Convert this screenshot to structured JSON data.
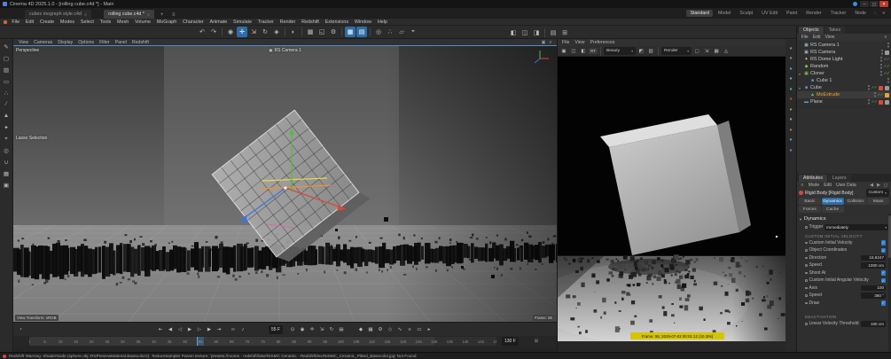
{
  "window": {
    "title": "Cinema 4D 2025.1.0 - [rolling cube.c4d *] - Main",
    "minimize_glyph": "─",
    "maximize_glyph": "▢",
    "close_glyph": "✕"
  },
  "document_tabs": {
    "tabs": [
      {
        "label": "cubes mograph style.c4d",
        "active": false
      },
      {
        "label": "rolling cube.c4d *",
        "active": true
      }
    ],
    "add_label": "+",
    "menu_glyph": "≡"
  },
  "layout_switcher": {
    "items": [
      "Standard",
      "Model",
      "Sculpt",
      "UV Edit",
      "Paint",
      "Render",
      "Tracker",
      "Node"
    ],
    "active": "Standard"
  },
  "menubar": {
    "items": [
      "File",
      "Edit",
      "Create",
      "Modes",
      "Select",
      "Tools",
      "Mesh",
      "Volume",
      "MoGraph",
      "Character",
      "Animate",
      "Simulate",
      "Tracker",
      "Render",
      "Redshift",
      "Extensions",
      "Window",
      "Help"
    ]
  },
  "toolbar": {
    "tools": [
      {
        "name": "undo-button",
        "glyph": "↶"
      },
      {
        "name": "redo-button",
        "glyph": "↷"
      },
      {
        "sep": true
      },
      {
        "name": "live-selection-tool",
        "glyph": "◉"
      },
      {
        "name": "move-tool",
        "glyph": "✛",
        "active": true
      },
      {
        "name": "scale-tool",
        "glyph": "⇲"
      },
      {
        "name": "rotate-tool",
        "glyph": "↻"
      },
      {
        "name": "last-tool-button",
        "glyph": "◈"
      },
      {
        "sep": true
      },
      {
        "name": "coordinate-system-toggle",
        "glyph": "◐"
      },
      {
        "sep": true
      },
      {
        "name": "render-view-button",
        "glyph": "▦"
      },
      {
        "name": "render-region-button",
        "glyph": "◱"
      },
      {
        "name": "render-settings-button",
        "glyph": "⚙"
      },
      {
        "sep": true
      },
      {
        "name": "simulate-scene-toggle",
        "glyph": "▦",
        "active": true
      },
      {
        "name": "simulate-cache-toggle",
        "glyph": "▤",
        "active": true
      },
      {
        "sep": true
      },
      {
        "name": "snap-toggle",
        "glyph": "◎"
      },
      {
        "name": "quantize-toggle",
        "glyph": "∴"
      },
      {
        "name": "workplane-toggle",
        "glyph": "▱"
      },
      {
        "name": "axis-toggle",
        "glyph": "⌖"
      }
    ],
    "right_tools": [
      {
        "name": "layout-single-view-button",
        "glyph": "◧"
      },
      {
        "name": "layout-quad-view-button",
        "glyph": "◫"
      },
      {
        "name": "layout-panel-button",
        "glyph": "◨"
      },
      {
        "sep": true
      },
      {
        "name": "content-browser-button",
        "glyph": "▤"
      },
      {
        "name": "coordinates-manager-button",
        "glyph": "⊞"
      }
    ]
  },
  "left_palette": {
    "tools": [
      {
        "name": "make-editable-button",
        "glyph": "✎"
      },
      {
        "name": "model-mode-button",
        "glyph": "▢"
      },
      {
        "name": "texture-mode-button",
        "glyph": "▨"
      },
      {
        "name": "workplane-mode-button",
        "glyph": "▭"
      },
      {
        "name": "points-mode-button",
        "glyph": "∴"
      },
      {
        "name": "edges-mode-button",
        "glyph": "∕"
      },
      {
        "name": "polygons-mode-button",
        "glyph": "▲"
      },
      {
        "name": "tweak-mode-button",
        "glyph": "✦"
      },
      {
        "name": "enable-axis-button",
        "glyph": "⌖"
      },
      {
        "name": "viewport-solo-button",
        "glyph": "◎"
      },
      {
        "name": "snap-button",
        "glyph": "∪"
      },
      {
        "name": "grid-snap-button",
        "glyph": "▦"
      },
      {
        "name": "locked-workplane-button",
        "glyph": "▣"
      }
    ]
  },
  "viewport": {
    "menus": [
      "View",
      "Cameras",
      "Display",
      "Options",
      "Filter",
      "Panel",
      "Redshift"
    ],
    "corner_icons": [
      {
        "name": "viewport-maximize-icon",
        "glyph": "▣"
      },
      {
        "name": "viewport-options-icon",
        "glyph": "≡"
      }
    ],
    "view_label": "Perspective",
    "camera_label": "RS Camera 1",
    "tool_hint": "Lasso Selection",
    "view_transform_label": "View Transform: sRGB",
    "stats_label": "Frame: 55"
  },
  "renderview": {
    "menus": [
      "File",
      "View",
      "Preferences"
    ],
    "left_icons": [
      {
        "name": "save-image-icon",
        "glyph": "▣"
      },
      {
        "name": "snapshot-icon",
        "glyph": "◫"
      },
      {
        "name": "ab-compare-icon",
        "glyph": "◧"
      }
    ],
    "rt_label": "RT",
    "aov": "Beauty",
    "channel_icons": [
      {
        "name": "rgb-channel-icon",
        "glyph": "◩"
      },
      {
        "name": "alpha-channel-icon",
        "glyph": "▨"
      }
    ],
    "engine": "Render",
    "right_icons": [
      {
        "name": "region-render-icon",
        "glyph": "▢"
      },
      {
        "name": "zoom-fit-icon",
        "glyph": "⇲"
      },
      {
        "name": "bucket-icon",
        "glyph": "▦"
      },
      {
        "name": "denoise-icon",
        "glyph": "◬"
      }
    ],
    "info_bar": "Frame: 55; 2025-07-03 00:01:12 (10.39s)"
  },
  "right_strip": {
    "icons": [
      {
        "name": "asset-browser-icon",
        "glyph": "●",
        "color": "#8d8d8d"
      },
      {
        "name": "material-icon",
        "glyph": "●",
        "color": "#7d8a99"
      },
      {
        "name": "sky-icon",
        "glyph": "●",
        "color": "#4f9bd6"
      },
      {
        "name": "floor-icon",
        "glyph": "●",
        "color": "#9a9a9a"
      },
      {
        "name": "environment-icon",
        "glyph": "●",
        "color": "#4cae9e"
      },
      {
        "name": "dynamics-icon",
        "glyph": "●",
        "color": "#c84b3c"
      },
      {
        "name": "mograph-icon",
        "glyph": "●",
        "color": "#6fae4f"
      },
      {
        "name": "volume-icon",
        "glyph": "●",
        "color": "#9a9a9a"
      },
      {
        "name": "field-icon",
        "glyph": "●",
        "color": "#b07a3e"
      },
      {
        "name": "camera-palette-icon",
        "glyph": "●",
        "color": "#8888aa"
      },
      {
        "name": "light-palette-icon",
        "glyph": "●",
        "color": "#5588cc"
      }
    ]
  },
  "objects_panel": {
    "tabs": [
      {
        "label": "Objects",
        "active": true
      },
      {
        "label": "Takes",
        "active": false
      }
    ],
    "menus": [
      "File",
      "Edit",
      "View"
    ],
    "menu_icon": "≡",
    "items": [
      {
        "label": "RS Camera 1",
        "type": "camera",
        "indent": 0,
        "checks": false,
        "tags": []
      },
      {
        "label": "RS Camera",
        "type": "camera",
        "indent": 0,
        "checks": false,
        "tags": [
          "gray"
        ]
      },
      {
        "label": "RS Dome Light",
        "type": "light",
        "indent": 0,
        "checks": true,
        "tags": []
      },
      {
        "label": "Random",
        "type": "effector",
        "indent": 0,
        "checks": true,
        "tags": []
      },
      {
        "label": "Cloner",
        "type": "cloner",
        "indent": 0,
        "checks": true,
        "expander": true,
        "tags": []
      },
      {
        "label": "Cube 1",
        "type": "cube",
        "indent": 1,
        "checks": false,
        "tags": []
      },
      {
        "label": "Cube",
        "type": "cube",
        "indent": 0,
        "checks": true,
        "expander": true,
        "tags": [
          "red",
          "gray"
        ]
      },
      {
        "label": "MoExtrude",
        "type": "moextrude",
        "indent": 1,
        "checks": true,
        "selected": true,
        "tags": [
          "orange"
        ]
      },
      {
        "label": "Plane",
        "type": "plane",
        "indent": 0,
        "checks": true,
        "tags": [
          "red",
          "gray"
        ]
      }
    ]
  },
  "attributes_panel": {
    "tabs": [
      {
        "label": "Attributes",
        "active": true
      },
      {
        "label": "Layers",
        "active": false
      }
    ],
    "menus": [
      "Mode",
      "Edit",
      "User Data"
    ],
    "menu_icon": "≡",
    "nav_icons": [
      {
        "name": "history-back-icon",
        "glyph": "◀"
      },
      {
        "name": "history-forward-icon",
        "glyph": "▶"
      },
      {
        "name": "lock-icon",
        "glyph": "◻"
      }
    ],
    "title": "Rigid Body [Rigid Body]",
    "preset": "Custom",
    "tab_buttons": [
      {
        "label": "Basic"
      },
      {
        "label": "Dynamics",
        "active": true
      },
      {
        "label": "Collision"
      },
      {
        "label": "Mass"
      },
      {
        "label": "Forces"
      },
      {
        "label": "Cache"
      }
    ],
    "section": "Dynamics",
    "rows": [
      {
        "type": "select",
        "label": "Trigger",
        "value": "Immediately"
      },
      {
        "type": "header",
        "label": "Custom Initial Velocity"
      },
      {
        "type": "check",
        "label": "Custom Initial Velocity",
        "checked": true
      },
      {
        "type": "check",
        "label": "Object Coordinates",
        "checked": true
      },
      {
        "type": "field",
        "label": "Direction",
        "value": "15.6247"
      },
      {
        "type": "field",
        "label": "Speed",
        "value": "1000 cm"
      },
      {
        "type": "check",
        "label": "Shoot At",
        "checked": true
      },
      {
        "type": "check",
        "label": "Custom Initial Angular Velocity",
        "checked": true
      },
      {
        "type": "field",
        "label": "Axis",
        "value": "100"
      },
      {
        "type": "field",
        "label": "Speed",
        "value": "360 °"
      },
      {
        "type": "check",
        "label": "Draw",
        "checked": true
      },
      {
        "type": "header",
        "label": "Deactivation",
        "gap": true
      },
      {
        "type": "field",
        "label": "Linear Velocity Threshold",
        "value": "100 cm"
      }
    ]
  },
  "timeline": {
    "ticks_start": 0,
    "ticks_end": 150,
    "tick_step": 5,
    "current_frame": 55,
    "range_end_frame": 130,
    "current_frame_label": "55 F",
    "range_end_label": "130 F",
    "nav_icon": "◔",
    "transport": [
      {
        "name": "go-to-start-button",
        "glyph": "⇤"
      },
      {
        "name": "previous-key-button",
        "glyph": "◀"
      },
      {
        "name": "previous-frame-button",
        "glyph": "◁"
      },
      {
        "name": "play-button",
        "glyph": "▶"
      },
      {
        "name": "next-frame-button",
        "glyph": "▷"
      },
      {
        "name": "next-key-button",
        "glyph": "▶"
      },
      {
        "name": "go-to-end-button",
        "glyph": "⇥"
      }
    ],
    "loop_icons": [
      {
        "name": "loop-playback-toggle",
        "glyph": "∞"
      },
      {
        "name": "sound-toggle",
        "glyph": "♪"
      }
    ],
    "key_icons": [
      {
        "name": "record-keyframe-button",
        "glyph": "⊙"
      },
      {
        "name": "autokey-toggle",
        "glyph": "◉"
      },
      {
        "name": "position-key-toggle",
        "glyph": "✛"
      },
      {
        "name": "scale-key-toggle",
        "glyph": "⇲"
      },
      {
        "name": "rotation-key-toggle",
        "glyph": "↻"
      },
      {
        "name": "parameter-key-toggle",
        "glyph": "▤"
      }
    ],
    "extra_icons": [
      {
        "name": "keying-settings-icon",
        "glyph": "◆"
      },
      {
        "name": "hud-toggle",
        "glyph": "▦"
      },
      {
        "name": "timeline-settings-icon",
        "glyph": "⚙"
      },
      {
        "name": "marker-icon",
        "glyph": "◇"
      },
      {
        "name": "fcurve-icon",
        "glyph": "∿"
      },
      {
        "name": "dopesheet-icon",
        "glyph": "≡"
      },
      {
        "name": "ruler-options-icon",
        "glyph": "▭"
      },
      {
        "name": "playback-rate-icon",
        "glyph": "▸"
      }
    ]
  },
  "statusbar": {
    "text": "Redshift Warning: ShaderNode (sphere.obj::RSPreviewMaterial.Basecolor2): TextureSampler Param texture: 'presets://rooms - redshift/lake/NISMC Ceramic - Redshift/tex/NISMC_Ceramic_Pitted_Basecolor.jpg' Not Found"
  },
  "colors": {
    "accent_blue": "#2e6da8",
    "selection_orange": "#f0a030",
    "check_green": "#7ac24f",
    "tag_red": "#d84a3a",
    "info_yellow": "#d6c400"
  }
}
